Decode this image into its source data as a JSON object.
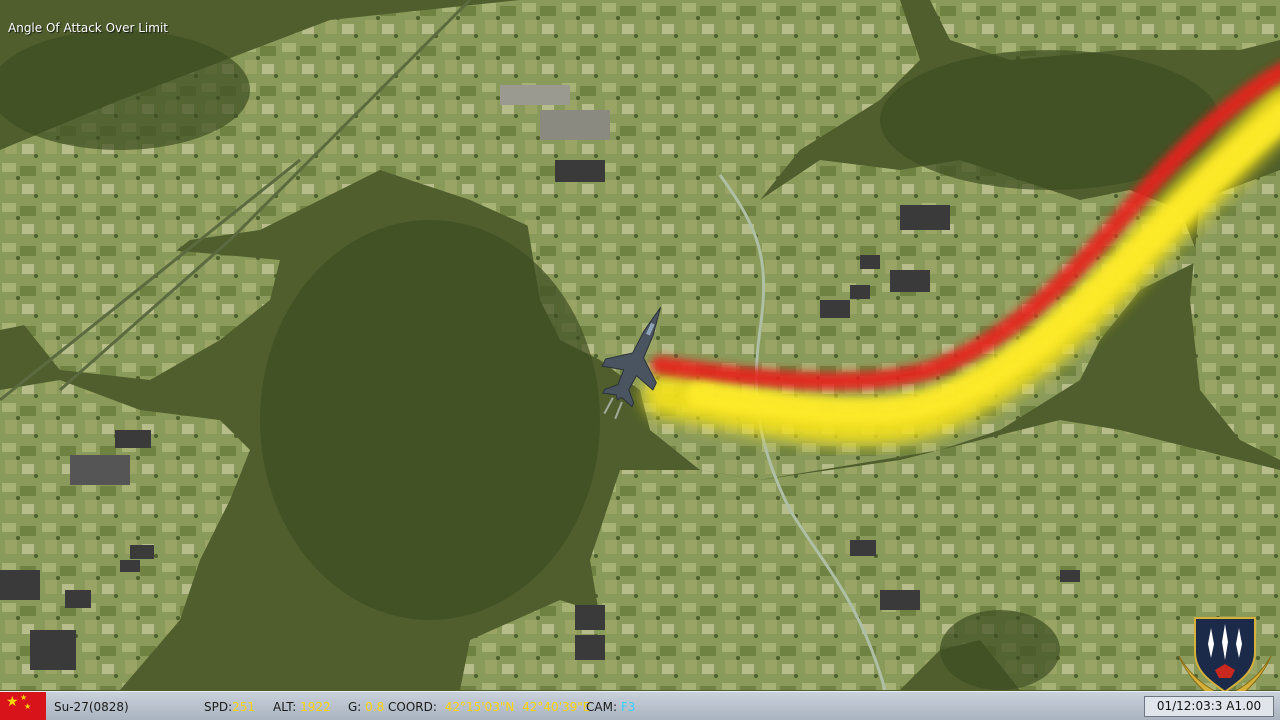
{
  "hud": {
    "warning_text": "Angle Of Attack Over Limit"
  },
  "status_bar": {
    "aircraft": "Su-27(0828)",
    "spd_label": "SPD:",
    "spd_value": "251",
    "alt_label": "ALT:",
    "alt_value": "1922",
    "g_label": "G:",
    "g_value": "0.8",
    "coord_label": "COORD:",
    "lat": "42°15'03\"N",
    "lon": "42°40'39\"E",
    "cam_label": "CAM:",
    "cam_value": "F3",
    "time": "01/12:03:3",
    "speed_factor": "A1.00"
  },
  "colors": {
    "spd_value": "#ffd400",
    "cam_value": "#3ad0ff",
    "smoke_red": "#e8241e",
    "smoke_yellow": "#f2e01c",
    "flag_red": "#d8141a"
  },
  "icons": {
    "flag": "china-flag-icon",
    "emblem": "squadron-emblem-icon",
    "aircraft": "su27-jet-icon"
  }
}
